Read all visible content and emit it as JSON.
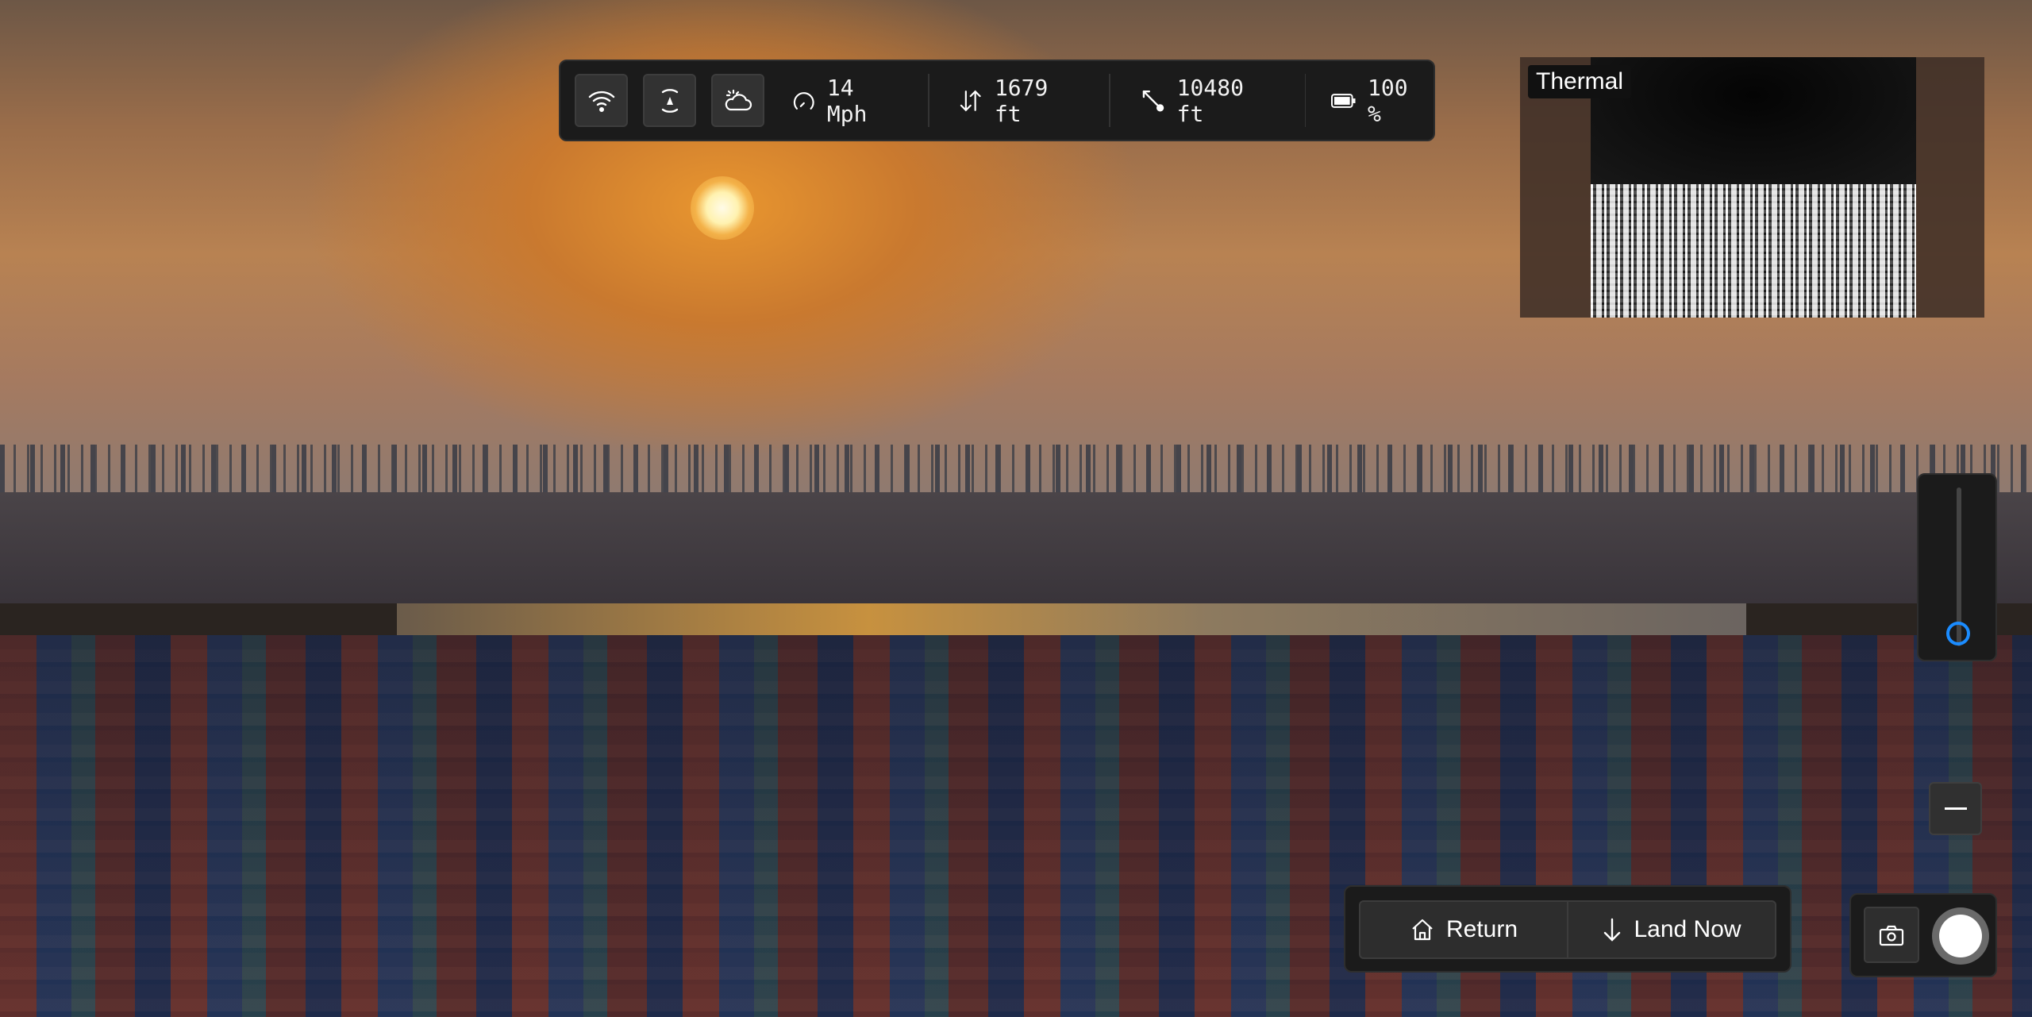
{
  "toolbar": {
    "buttons": [
      {
        "icon": "wifi-icon"
      },
      {
        "icon": "gimbal-center-icon"
      },
      {
        "icon": "weather-icon"
      }
    ],
    "stats": [
      {
        "icon": "speedometer-icon",
        "value": "14 Mph"
      },
      {
        "icon": "altitude-arrows-icon",
        "value": "1679 ft"
      },
      {
        "icon": "distance-icon",
        "value": "10480 ft"
      },
      {
        "icon": "battery-icon",
        "value": "100 %"
      }
    ]
  },
  "thermal": {
    "label": "Thermal"
  },
  "zoom_slider": {
    "level": 0.08,
    "accent": "#1b8cff"
  },
  "actions": {
    "return_label": "Return",
    "land_label": "Land Now"
  },
  "camera": {
    "photo_icon": "camera-icon",
    "shutter_icon": "shutter-icon"
  }
}
